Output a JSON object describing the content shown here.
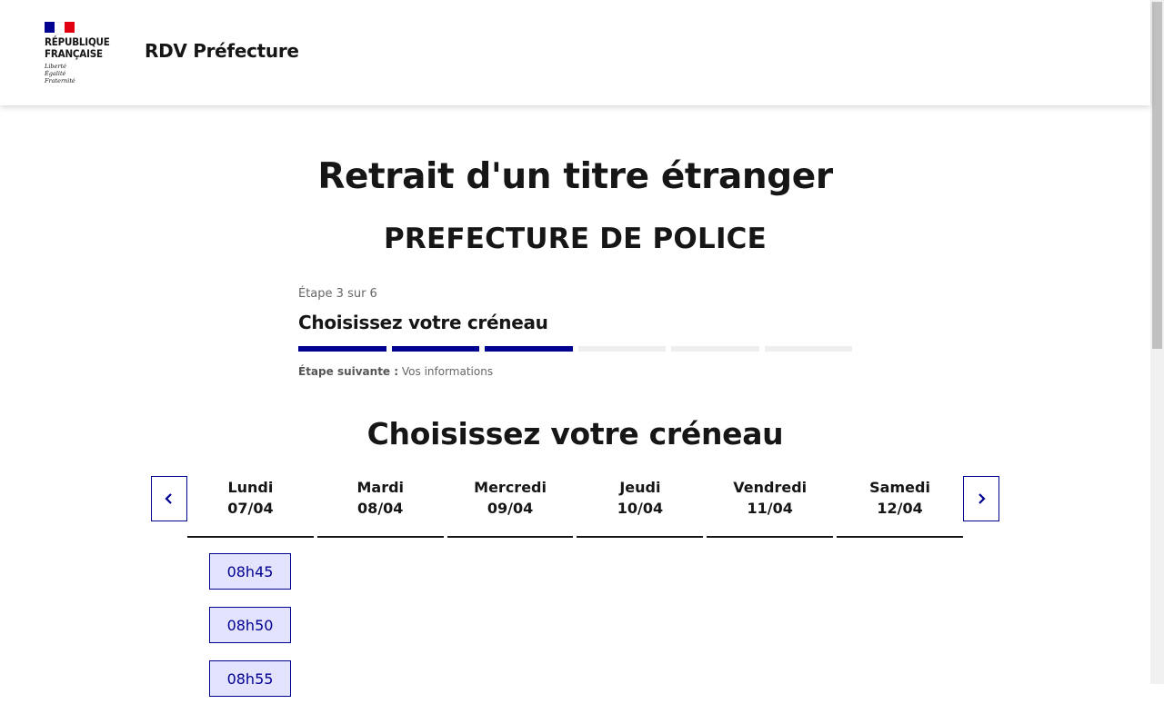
{
  "header": {
    "logo": {
      "line1": "RÉPUBLIQUE",
      "line2": "FRANÇAISE",
      "motto": [
        "Liberté",
        "Égalité",
        "Fraternité"
      ],
      "flag_colors": [
        "#000091",
        "#ffffff",
        "#e1000f"
      ]
    },
    "service_title": "RDV Préfecture"
  },
  "main": {
    "title": "Retrait d'un titre étranger",
    "subtitle": "PREFECTURE DE POLICE"
  },
  "stepper": {
    "state": "Étape 3 sur 6",
    "title": "Choisissez votre créneau",
    "current_step": 3,
    "total_steps": 6,
    "next_label": "Étape suivante :",
    "next_value": "Vos informations"
  },
  "calendar": {
    "title": "Choisissez votre créneau",
    "prev_icon": "chevron-left-icon",
    "next_icon": "chevron-right-icon",
    "days": [
      {
        "name": "Lundi",
        "date": "07/04"
      },
      {
        "name": "Mardi",
        "date": "08/04"
      },
      {
        "name": "Mercredi",
        "date": "09/04"
      },
      {
        "name": "Jeudi",
        "date": "10/04"
      },
      {
        "name": "Vendredi",
        "date": "11/04"
      },
      {
        "name": "Samedi",
        "date": "12/04"
      }
    ],
    "slots": [
      "08h45",
      "08h50",
      "08h55"
    ]
  },
  "colors": {
    "accent": "#000091",
    "slot_bg": "#e3e3fd",
    "step_inactive": "#eeeeee"
  }
}
